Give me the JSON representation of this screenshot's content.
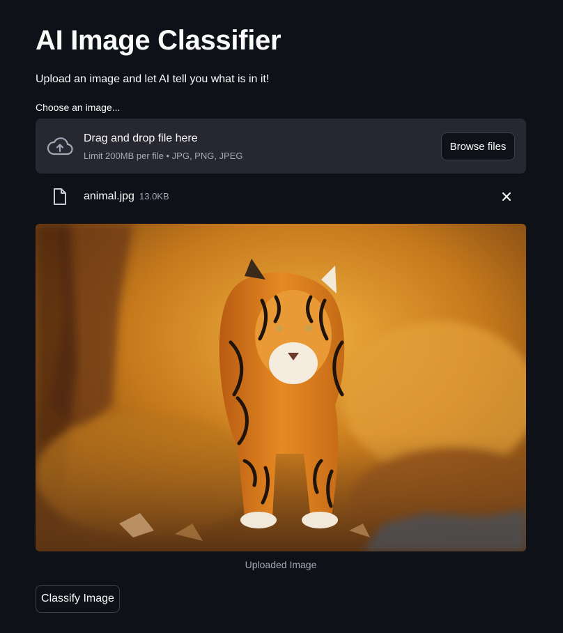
{
  "page": {
    "title": "AI Image Classifier",
    "subtitle": "Upload an image and let AI tell you what is in it!"
  },
  "uploader": {
    "label": "Choose an image...",
    "drop_text": "Drag and drop file here",
    "limit_text": "Limit 200MB per file • JPG, PNG, JPEG",
    "browse_label": "Browse files",
    "icon": "cloud-upload-icon"
  },
  "uploaded_file": {
    "name": "animal.jpg",
    "size": "13.0KB",
    "icon": "file-icon",
    "remove_icon": "close-icon"
  },
  "image": {
    "caption": "Uploaded Image"
  },
  "actions": {
    "classify_label": "Classify Image"
  },
  "colors": {
    "background": "#0e1117",
    "surface": "#262730",
    "text": "#fafafa",
    "muted_text": "#a3a8b8",
    "border": "#3d404a"
  }
}
